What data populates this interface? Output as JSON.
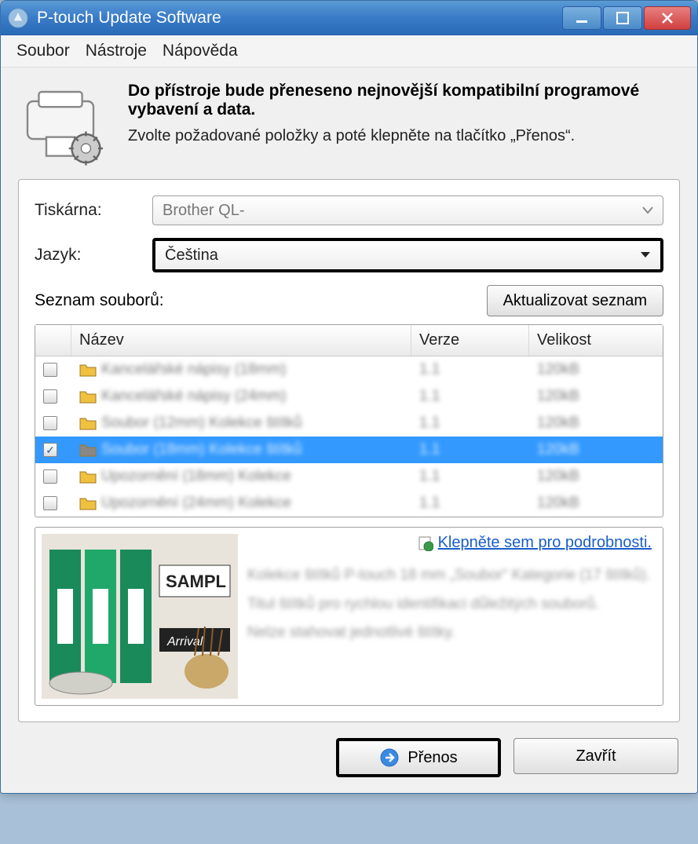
{
  "window": {
    "title": "P-touch Update Software"
  },
  "menu": {
    "file": "Soubor",
    "tools": "Nástroje",
    "help": "Nápověda"
  },
  "header": {
    "heading": "Do přístroje bude přeneseno nejnovější kompatibilní programové vybavení a data.",
    "sub": "Zvolte požadované položky a poté klepněte na tlačítko „Přenos“."
  },
  "form": {
    "printer_label": "Tiskárna:",
    "printer_value": "Brother QL-",
    "language_label": "Jazyk:",
    "language_value": "Čeština"
  },
  "list": {
    "caption": "Seznam souborů:",
    "refresh": "Aktualizovat seznam",
    "columns": {
      "name": "Název",
      "version": "Verze",
      "size": "Velikost"
    },
    "rows": [
      {
        "checked": false,
        "selected": false,
        "name": "Kancelářské nápisy (18mm)",
        "ver": "1.1",
        "size": "120kB",
        "folder": "yellow"
      },
      {
        "checked": false,
        "selected": false,
        "name": "Kancelářské nápisy (24mm)",
        "ver": "1.1",
        "size": "120kB",
        "folder": "yellow"
      },
      {
        "checked": false,
        "selected": false,
        "name": "Soubor (12mm) Kolekce štítků",
        "ver": "1.1",
        "size": "120kB",
        "folder": "yellow"
      },
      {
        "checked": true,
        "selected": true,
        "name": "Soubor (18mm) Kolekce štítků",
        "ver": "1.1",
        "size": "120kB",
        "folder": "gray"
      },
      {
        "checked": false,
        "selected": false,
        "name": "Upozornění (18mm) Kolekce",
        "ver": "1.1",
        "size": "120kB",
        "folder": "yellow"
      },
      {
        "checked": false,
        "selected": false,
        "name": "Upozornění (24mm) Kolekce",
        "ver": "1.1",
        "size": "120kB",
        "folder": "yellow"
      }
    ]
  },
  "detail": {
    "link": "Klepněte sem pro podrobnosti.",
    "line1": "Kolekce štítků P-touch 18 mm „Soubor“ Kategorie (17 štítků).",
    "line2": "Titul štítků pro rychlou identifikaci důležitých souborů.",
    "line3": "Nelze stahovat jednotlivé štítky."
  },
  "footer": {
    "transfer": "Přenos",
    "close": "Zavřít"
  }
}
